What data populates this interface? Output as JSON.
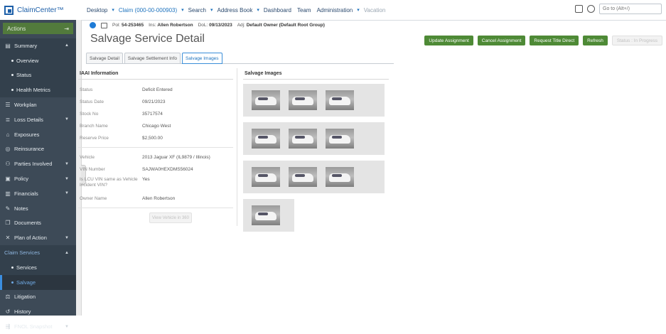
{
  "topbar": {
    "app_name": "ClaimCenter™",
    "nav": [
      "Desktop",
      "Claim (000-00-000903)",
      "Search",
      "Address Book",
      "Dashboard",
      "Team",
      "Administration",
      "Vacation"
    ],
    "goto_placeholder": "Go to (Alt+/)"
  },
  "sidebar": {
    "actions_label": "Actions",
    "items": [
      {
        "label": "Summary",
        "icon": "summary-icon"
      },
      {
        "label": "Overview"
      },
      {
        "label": "Status"
      },
      {
        "label": "Health Metrics"
      },
      {
        "label": "Workplan",
        "icon": "workplan-icon"
      },
      {
        "label": "Loss Details",
        "icon": "loss-details-icon"
      },
      {
        "label": "Exposures",
        "icon": "exposures-icon"
      },
      {
        "label": "Reinsurance",
        "icon": "reinsurance-icon"
      },
      {
        "label": "Parties Involved",
        "icon": "parties-icon"
      },
      {
        "label": "Policy",
        "icon": "policy-icon"
      },
      {
        "label": "Financials",
        "icon": "financials-icon"
      },
      {
        "label": "Notes",
        "icon": "notes-icon"
      },
      {
        "label": "Documents",
        "icon": "documents-icon"
      },
      {
        "label": "Plan of Action",
        "icon": "plan-icon"
      },
      {
        "label": "Claim Services"
      },
      {
        "label": "Services"
      },
      {
        "label": "Salvage"
      },
      {
        "label": "Litigation",
        "icon": "litigation-icon"
      },
      {
        "label": "History",
        "icon": "history-icon"
      },
      {
        "label": "FNOL Snapshot",
        "icon": "fnol-icon"
      }
    ]
  },
  "infobar": {
    "pol_label": "Pol:",
    "pol_value": "54-253465",
    "ins_label": "Ins:",
    "ins_value": "Allen Robertson",
    "dol_label": "DoL:",
    "dol_value": "09/13/2023",
    "adj_label": "Adj:",
    "adj_value": "Default Owner (Default Root Group)"
  },
  "page": {
    "title": "Salvage Service Detail",
    "buttons": {
      "update": "Update Assignment",
      "cancel": "Cancel Assignment",
      "request": "Request Title Direct",
      "refresh": "Refresh",
      "status": "Status : In Progress"
    },
    "tabs": [
      "Salvage Detail",
      "Salvage Settlement Info",
      "Salvage Images"
    ]
  },
  "iaai": {
    "heading": "IAAI Information",
    "fields1": [
      {
        "label": "Status",
        "value": "Deficit Entered"
      },
      {
        "label": "Status Date",
        "value": "09/21/2023"
      },
      {
        "label": "Stock No",
        "value": "35717574"
      },
      {
        "label": "Branch Name",
        "value": "Chicago West"
      },
      {
        "label": "Reserve Price",
        "value": "$2,500.00"
      }
    ],
    "fields2": [
      {
        "label": "Vehicle",
        "value": "2013 Jaguar XF (IL9879 / Illinois)"
      },
      {
        "label": "VIN Number",
        "value": "SAJWA0HEXDMS56024"
      },
      {
        "label": "Is LCU VIN same as Vehicle Incident VIN?",
        "value": "Yes"
      },
      {
        "label": "Owner Name",
        "value": "Allen Robertson"
      }
    ],
    "view_button": "View Vehicle in 360"
  },
  "salvage_images": {
    "heading": "Salvage Images"
  }
}
